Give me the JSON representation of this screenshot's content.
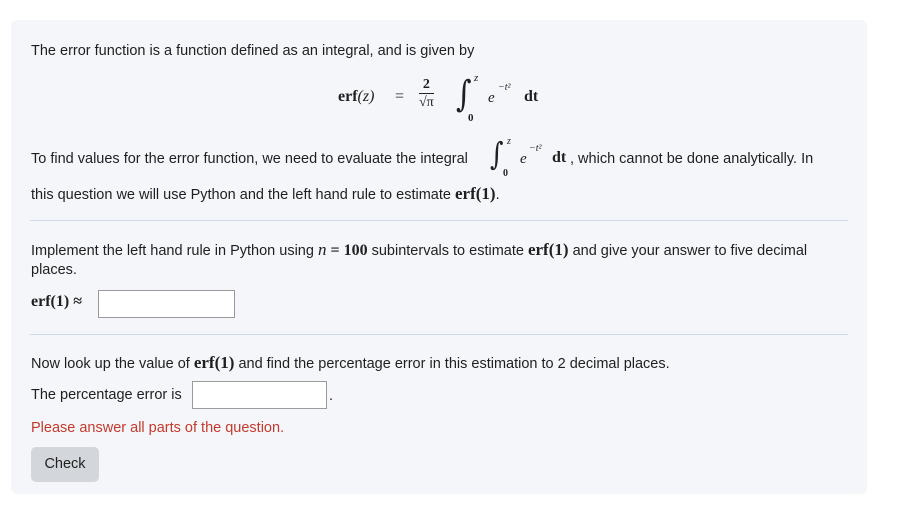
{
  "intro": {
    "text": "The error function is a function defined as an integral, and is given by"
  },
  "formula": {
    "lhs": "erf",
    "lhs_arg": "(z)",
    "equals": "=",
    "numerator": "2",
    "denominator": "√π",
    "upper_limit": "z",
    "lower_limit": "0",
    "integrand_base": "e",
    "integrand_exp": "−t²",
    "differential": "dt"
  },
  "para2": {
    "line1_prefix": "To find values for the error function, we need to evaluate the integral",
    "line1_suffix": ", which cannot be done analytically. In",
    "line2_prefix": "this question we will use Python and the left hand rule to estimate",
    "line2_math": "erf(1)",
    "line2_suffix": "."
  },
  "part1": {
    "line1_a": "Implement the left hand rule in Python using",
    "n_var": "n",
    "n_eq": " = 100",
    "line1_b": "subintervals to estimate",
    "line1_math": "erf(1)",
    "line1_c": "and give your answer to five decimal",
    "line2": "places.",
    "answer_label": "erf(1) ≈",
    "answer_value": ""
  },
  "part2": {
    "text_a": "Now look up the value of",
    "text_math": "erf(1)",
    "text_b": "and find the percentage error in this estimation to 2 decimal places.",
    "answer_label": "The percentage error is",
    "answer_value": "",
    "after_input": "."
  },
  "warning": "Please answer all parts of the question.",
  "check_label": "Check",
  "colors": {
    "card_bg": "#f4f6f9",
    "warning": "#c43a2d",
    "button_bg": "#d3d6da"
  }
}
